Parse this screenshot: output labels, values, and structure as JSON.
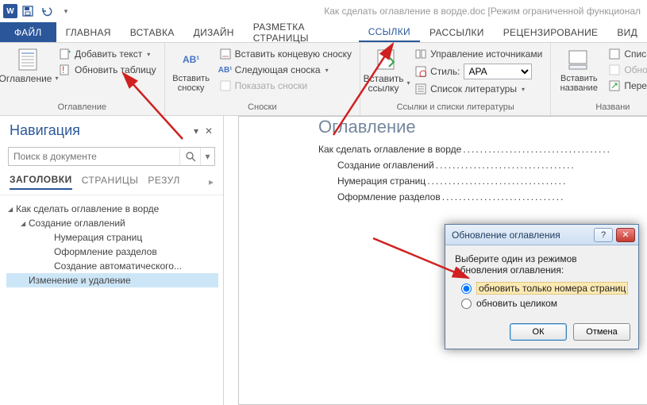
{
  "titlebar": {
    "doc_title": "Как сделать оглавление в ворде.doc [Режим ограниченной функционал"
  },
  "tabs": {
    "file": "ФАЙЛ",
    "list": [
      "ГЛАВНАЯ",
      "ВСТАВКА",
      "ДИЗАЙН",
      "РАЗМЕТКА СТРАНИЦЫ",
      "ССЫЛКИ",
      "РАССЫЛКИ",
      "РЕЦЕНЗИРОВАНИЕ",
      "ВИД"
    ],
    "active_index": 4
  },
  "ribbon": {
    "group_toc": {
      "big": "Оглавление",
      "add_text": "Добавить текст",
      "update": "Обновить таблицу",
      "label": "Оглавление"
    },
    "group_footnotes": {
      "big": "Вставить\nсноску",
      "ab_badge": "AB¹",
      "insert_end": "Вставить концевую сноску",
      "next": "Следующая сноска",
      "show": "Показать сноски",
      "label": "Сноски"
    },
    "group_citations": {
      "big": "Вставить\nссылку",
      "manage": "Управление источниками",
      "style_label": "Стиль:",
      "style_value": "APA",
      "biblio": "Список литературы",
      "label": "Ссылки и списки литературы"
    },
    "group_captions": {
      "big": "Вставить\nназвание",
      "list_fig": "Список и",
      "update_tbl": "Обновит",
      "cross": "Перекрес",
      "label": "Названи"
    }
  },
  "nav": {
    "title": "Навигация",
    "search_placeholder": "Поиск в документе",
    "tabs": [
      "ЗАГОЛОВКИ",
      "СТРАНИЦЫ",
      "РЕЗУЛ"
    ],
    "tree": {
      "root": "Как сделать оглавление в ворде",
      "n1": "Создание оглавлений",
      "n1a": "Нумерация страниц",
      "n1b": "Оформление разделов",
      "n1c": "Создание автоматического...",
      "n2": "Изменение и удаление"
    }
  },
  "document": {
    "heading": "Оглавление",
    "lines": [
      {
        "level": 1,
        "text": "Как сделать оглавление в ворде"
      },
      {
        "level": 2,
        "text": "Создание оглавлений"
      },
      {
        "level": 2,
        "text": "Нумерация страниц"
      },
      {
        "level": 2,
        "text": "Оформление разделов"
      }
    ]
  },
  "dialog": {
    "title": "Обновление оглавления",
    "prompt": "Выберите один из режимов обновления оглавления:",
    "opt_numbers": "обновить только номера страниц",
    "opt_all": "обновить целиком",
    "ok": "ОК",
    "cancel": "Отмена"
  }
}
